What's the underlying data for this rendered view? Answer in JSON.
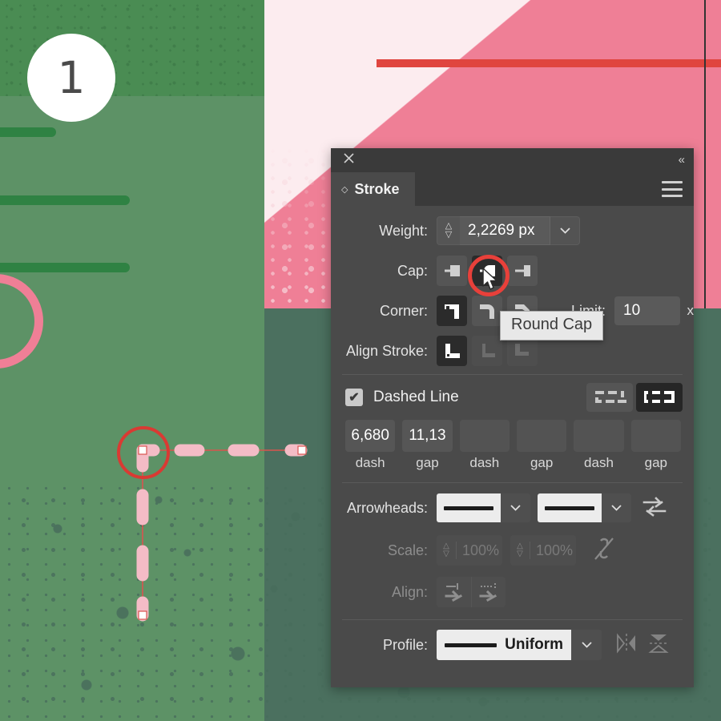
{
  "artwork": {
    "badge_number": "1",
    "colors": {
      "green_mid": "#5d9266",
      "green_dark": "#4b705f",
      "green_top": "#4a8c53",
      "bar_green": "#2f8243",
      "pink": "#ef7f96",
      "pink_light": "#fcecef",
      "red_line": "#e0453f",
      "annotation_red": "#e8403a",
      "path_pink": "#f4bcc6"
    }
  },
  "panel": {
    "title": "Stroke",
    "close_icon": "close-icon",
    "collapse_icon": "«",
    "menu_icon": "hamburger-menu-icon",
    "weight": {
      "label": "Weight:",
      "value": "2,2269 px",
      "stepper_up": "∧",
      "stepper_down": "∨",
      "chevron": "∨"
    },
    "cap": {
      "label": "Cap:",
      "options": [
        "butt-cap",
        "round-cap",
        "projecting-cap"
      ],
      "selected_index": 1
    },
    "corner": {
      "label": "Corner:",
      "options": [
        "miter-join",
        "round-join",
        "bevel-join"
      ],
      "selected_index": 0,
      "limit_label": "Limit:",
      "limit_value": "10",
      "limit_suffix": "x"
    },
    "align_stroke": {
      "label": "Align Stroke:",
      "options": [
        "align-center",
        "align-inside",
        "align-outside"
      ],
      "selected_index": 0
    },
    "dashed_line": {
      "label": "Dashed Line",
      "checked": true,
      "check_glyph": "✔",
      "presets": [
        "dash-preserve-exact",
        "dash-align-corners"
      ],
      "selected_preset": 1,
      "fields": [
        {
          "value": "6,680",
          "caption": "dash"
        },
        {
          "value": "11,13",
          "caption": "gap"
        },
        {
          "value": "",
          "caption": "dash"
        },
        {
          "value": "",
          "caption": "gap"
        },
        {
          "value": "",
          "caption": "dash"
        },
        {
          "value": "",
          "caption": "gap"
        }
      ]
    },
    "arrowheads": {
      "label": "Arrowheads:",
      "start_value": "None",
      "end_value": "None",
      "swap_icon": "swap-arrows-icon",
      "chevron": "∨"
    },
    "scale": {
      "label": "Scale:",
      "start_value": "100%",
      "end_value": "100%",
      "link_icon": "broken-link-icon",
      "disabled": true
    },
    "align_arrowheads": {
      "label": "Align:",
      "options": [
        "extend-arrow-beyond-end",
        "place-arrow-at-end"
      ],
      "disabled": true
    },
    "profile": {
      "label": "Profile:",
      "value": "Uniform",
      "chevron": "∨",
      "flip_horizontal_icon": "flip-horizontal-icon",
      "flip_vertical_icon": "flip-vertical-icon"
    }
  },
  "tooltip": {
    "text": "Round Cap"
  }
}
